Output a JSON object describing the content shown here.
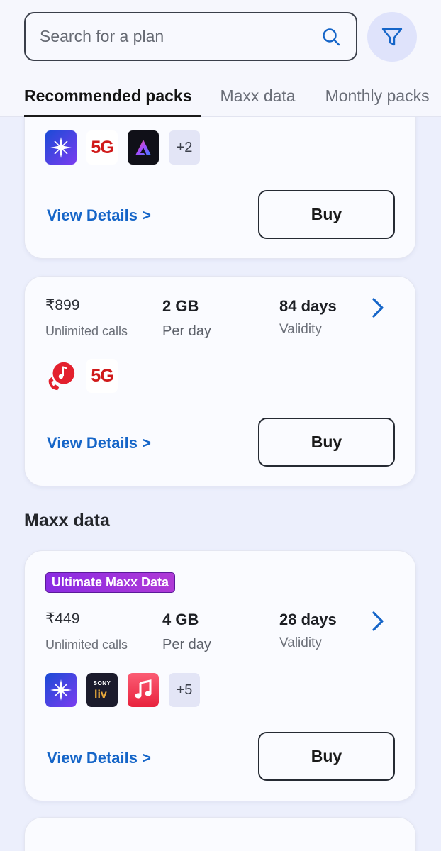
{
  "search": {
    "placeholder": "Search for a plan"
  },
  "tabs": [
    {
      "label": "Recommended packs"
    },
    {
      "label": "Maxx data"
    },
    {
      "label": "Monthly packs"
    }
  ],
  "cards": [
    {
      "icons": [
        "star-hotstar-icon",
        "5g-icon",
        "adobe-express-icon"
      ],
      "five_g": "5G",
      "more": "+2",
      "view_details": "View Details >",
      "buy": "Buy"
    },
    {
      "price": "₹899",
      "calls": "Unlimited calls",
      "data": "2 GB",
      "data_sub": "Per day",
      "validity": "84 days",
      "validity_sub": "Validity",
      "icons": [
        "music-call-icon",
        "5g-icon"
      ],
      "five_g": "5G",
      "view_details": "View Details >",
      "buy": "Buy"
    }
  ],
  "section": {
    "title": "Maxx data"
  },
  "maxx_card": {
    "badge": "Ultimate Maxx Data",
    "price": "₹449",
    "calls": "Unlimited calls",
    "data": "4 GB",
    "data_sub": "Per day",
    "validity": "28 days",
    "validity_sub": "Validity",
    "icons": [
      "star-hotstar-icon",
      "sony-liv-icon",
      "apple-music-icon"
    ],
    "sony_text": "SONY",
    "more": "+5",
    "view_details": "View Details >",
    "buy": "Buy"
  },
  "colors": {
    "accent": "#1565c8",
    "background": "#eceffc",
    "card": "#fafbff",
    "badge": "#8a2be2"
  }
}
